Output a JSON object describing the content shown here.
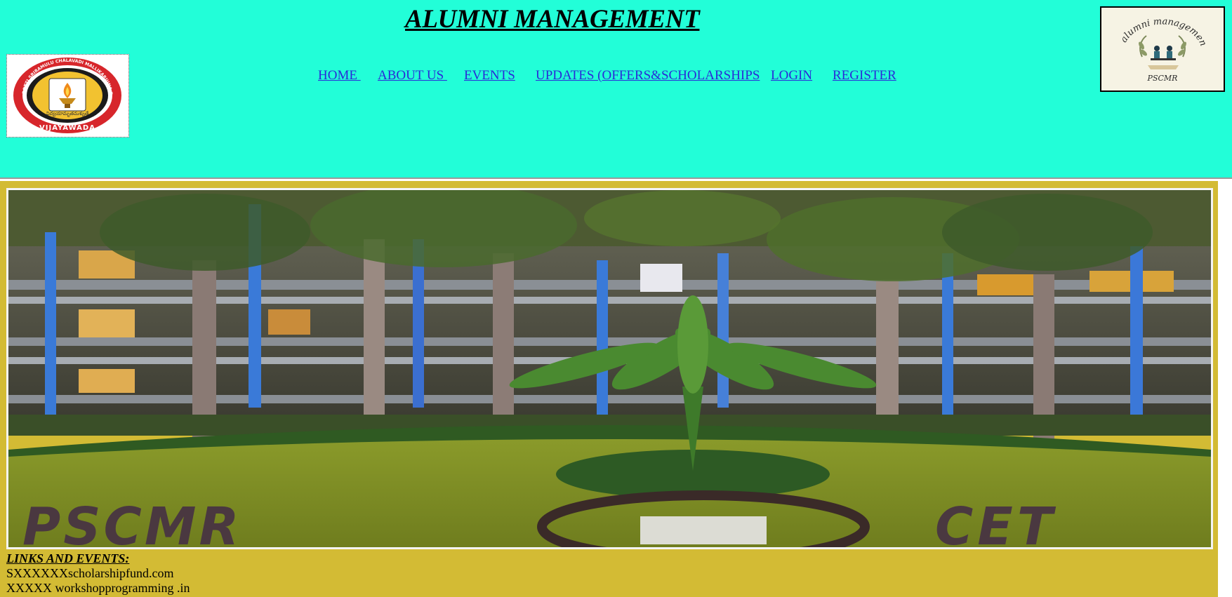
{
  "header": {
    "title": "ALUMNI MANAGEMENT",
    "background_color": "#22fed8",
    "college_logo": {
      "ring_text_top": "POTTI SRIRAMULU CHALAVADI MALLIKARJUNA RAO COLLEGE OF ENGINEERING & TECHNOLOGY",
      "emblem_script": "విద్యయామృతమశ్నుతే",
      "ring_text_bottom": "VIJAYAWADA"
    },
    "app_logo": {
      "script_text": "alumni management",
      "caption": "PSCMR"
    }
  },
  "nav": {
    "link_color": "#2a2ad8",
    "items": [
      {
        "label": "HOME "
      },
      {
        "label": "ABOUT US "
      },
      {
        "label": "EVENTS"
      },
      {
        "label": "UPDATES (OFFERS&SCHOLARSHIPS"
      },
      {
        "label": "LOGIN"
      },
      {
        "label": "REGISTER"
      }
    ]
  },
  "main": {
    "background_color": "#d3bb34",
    "banner": {
      "ground_text_left": "PSCMR",
      "ground_text_right": "CET"
    },
    "links_section": {
      "heading": "LINKS AND EVENTS:",
      "items": [
        "SXXXXXXscholarshipfund.com",
        "XXXXX workshopprogramming .in"
      ]
    }
  }
}
